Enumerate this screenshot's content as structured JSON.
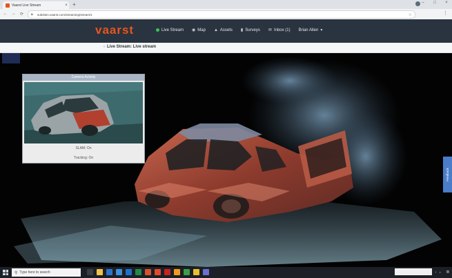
{
  "browser": {
    "tab_title": "Vaarst Live Stream",
    "url": "subslam.vaarst.com/streaming/stream/1",
    "close_glyph": "×",
    "newtab_glyph": "+",
    "window_controls": [
      "–",
      "□",
      "×"
    ]
  },
  "app": {
    "logo": "vaarst",
    "nav": [
      {
        "label": "Live Stream",
        "icon": "live-dot-icon"
      },
      {
        "label": "Map",
        "icon": "map-icon"
      },
      {
        "label": "Assets",
        "icon": "assets-icon"
      },
      {
        "label": "Surveys",
        "icon": "surveys-icon"
      },
      {
        "label": "Inbox (1)",
        "icon": "inbox-icon"
      },
      {
        "label": "Brian Allen",
        "icon": "chevron-down-icon"
      }
    ],
    "accent_color": "#e8551f",
    "live_color": "#38c35a"
  },
  "breadcrumb": "Live Stream: Live stream",
  "camera": {
    "title": "Camera Activity",
    "slam_status": "SLAM: On",
    "tracking_status": "Tracking: On"
  },
  "feedback_label": "Feedback",
  "taskbar": {
    "search_placeholder": "Type here to search"
  }
}
